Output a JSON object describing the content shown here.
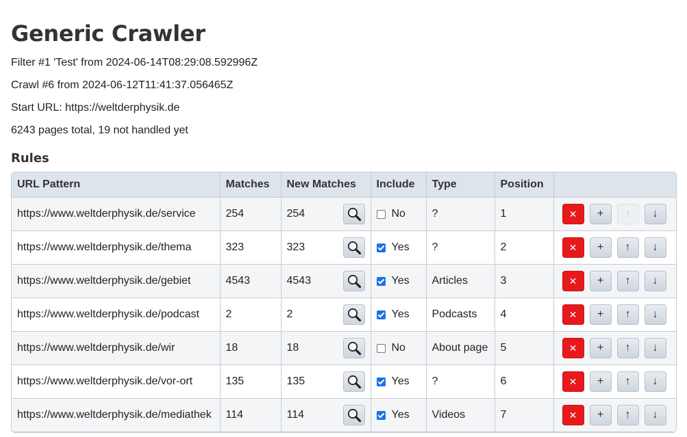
{
  "page": {
    "title": "Generic Crawler",
    "filter_info": "Filter #1 'Test' from 2024-06-14T08:29:08.592996Z",
    "crawl_info": "Crawl #6 from 2024-06-12T11:41:37.056465Z",
    "start_url": "Start URL: https://weltderphysik.de",
    "pages_info": "6243 pages total, 19 not handled yet"
  },
  "rules": {
    "heading": "Rules",
    "columns": [
      "URL Pattern",
      "Matches",
      "New Matches",
      "Include",
      "Type",
      "Position",
      ""
    ],
    "rows": [
      {
        "pattern": "https://www.weltderphysik.de/service",
        "matches": "254",
        "new_matches": "254",
        "include_checked": false,
        "include": "No",
        "type": "?",
        "position": "1",
        "up_disabled": true
      },
      {
        "pattern": "https://www.weltderphysik.de/thema",
        "matches": "323",
        "new_matches": "323",
        "include_checked": true,
        "include": "Yes",
        "type": "?",
        "position": "2",
        "up_disabled": false
      },
      {
        "pattern": "https://www.weltderphysik.de/gebiet",
        "matches": "4543",
        "new_matches": "4543",
        "include_checked": true,
        "include": "Yes",
        "type": "Articles",
        "position": "3",
        "up_disabled": false
      },
      {
        "pattern": "https://www.weltderphysik.de/podcast",
        "matches": "2",
        "new_matches": "2",
        "include_checked": true,
        "include": "Yes",
        "type": "Podcasts",
        "position": "4",
        "up_disabled": false
      },
      {
        "pattern": "https://www.weltderphysik.de/wir",
        "matches": "18",
        "new_matches": "18",
        "include_checked": false,
        "include": "No",
        "type": "About page",
        "position": "5",
        "up_disabled": false
      },
      {
        "pattern": "https://www.weltderphysik.de/vor-ort",
        "matches": "135",
        "new_matches": "135",
        "include_checked": true,
        "include": "Yes",
        "type": "?",
        "position": "6",
        "up_disabled": false
      },
      {
        "pattern": "https://www.weltderphysik.de/mediathek",
        "matches": "114",
        "new_matches": "114",
        "include_checked": true,
        "include": "Yes",
        "type": "Videos",
        "position": "7",
        "up_disabled": false
      }
    ],
    "icons": {
      "search": "magnifier-icon",
      "delete": "close-icon",
      "add": "plus-icon",
      "up": "arrow-up-icon",
      "down": "arrow-down-icon"
    },
    "glyphs": {
      "delete": "✕",
      "add": "+",
      "up": "↑",
      "down": "↓"
    },
    "colors": {
      "delete": "#e8191c",
      "header_bg": "#dde4ec",
      "checkbox": "#1a73e8"
    }
  }
}
